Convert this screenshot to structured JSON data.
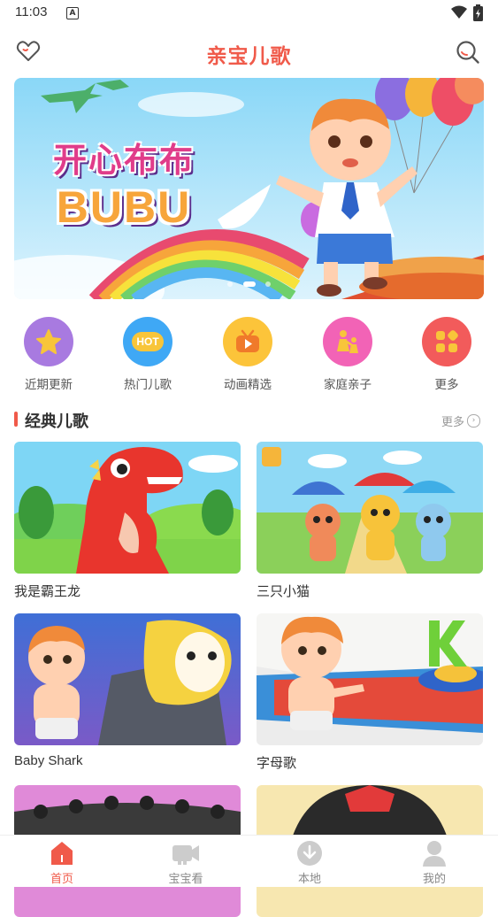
{
  "status": {
    "time": "11:03",
    "notification": "A"
  },
  "header": {
    "title": "亲宝儿歌",
    "favorite_icon": "heart-icon",
    "search_icon": "search-icon"
  },
  "banner": {
    "slogan": "开心布布",
    "brand": "BUBU"
  },
  "categories": [
    {
      "label": "近期更新",
      "icon": "star-icon",
      "color": "#a87ae0"
    },
    {
      "label": "热门儿歌",
      "icon": "hot-icon",
      "color": "#3fa8f5"
    },
    {
      "label": "动画精选",
      "icon": "tv-icon",
      "color": "#fcc43a"
    },
    {
      "label": "家庭亲子",
      "icon": "family-icon",
      "color": "#f263b6"
    },
    {
      "label": "更多",
      "icon": "grid-icon",
      "color": "#f25b5b"
    }
  ],
  "section": {
    "title": "经典儿歌",
    "more": "更多"
  },
  "videos": [
    {
      "title": "我是霸王龙"
    },
    {
      "title": "三只小猫"
    },
    {
      "title": "Baby Shark"
    },
    {
      "title": "字母歌"
    }
  ],
  "tabs": [
    {
      "label": "首页",
      "icon": "home-icon"
    },
    {
      "label": "宝宝看",
      "icon": "camera-icon"
    },
    {
      "label": "本地",
      "icon": "download-icon"
    },
    {
      "label": "我的",
      "icon": "user-icon"
    }
  ],
  "colors": {
    "accent": "#f05a4a",
    "muted": "#cccccc"
  }
}
